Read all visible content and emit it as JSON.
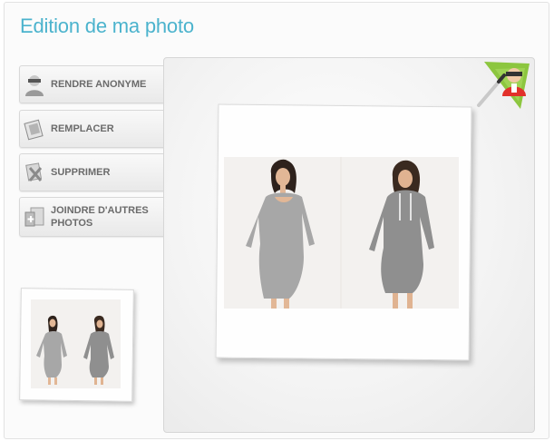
{
  "page": {
    "title": "Edition de ma photo"
  },
  "menu": [
    {
      "label": "RENDRE ANONYME",
      "icon": "anonymize-icon"
    },
    {
      "label": "REMPLACER",
      "icon": "replace-icon"
    },
    {
      "label": "SUPPRIMER",
      "icon": "delete-icon"
    },
    {
      "label": "JOINDRE D'AUTRES PHOTOS",
      "icon": "attach-photos-icon"
    }
  ],
  "colors": {
    "title": "#4bb3cd",
    "button_text": "#6b6b6b",
    "mascot_green": "#8cc63f",
    "mascot_red": "#e2312b"
  },
  "editor": {
    "corner_icon": "mascot-edit-icon",
    "photo": "two-women-grey-dresses-photo"
  },
  "thumbnail": {
    "photo": "two-women-grey-dresses-thumbnail"
  }
}
